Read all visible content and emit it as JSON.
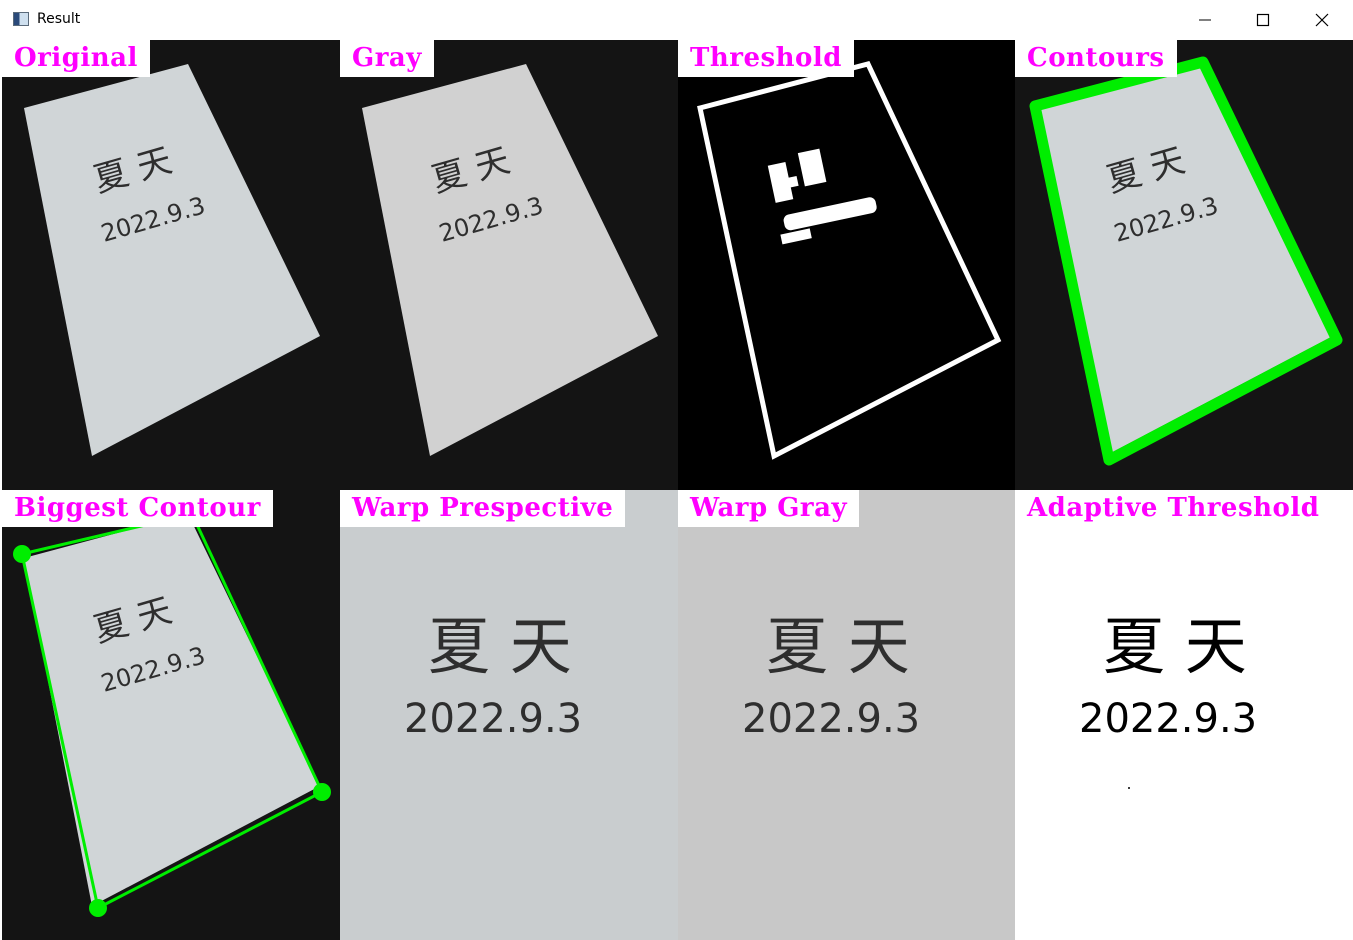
{
  "window": {
    "title": "Result"
  },
  "tiles": [
    {
      "label": "Original",
      "caption_cn": "夏 天",
      "caption_date": "2022.9.3"
    },
    {
      "label": "Gray",
      "caption_cn": "夏 天",
      "caption_date": "2022.9.3"
    },
    {
      "label": "Threshold"
    },
    {
      "label": "Contours",
      "caption_cn": "夏 天",
      "caption_date": "2022.9.3"
    },
    {
      "label": "Biggest Contour",
      "caption_cn": "夏 天",
      "caption_date": "2022.9.3"
    },
    {
      "label": "Warp Prespective",
      "caption_cn": "夏 天",
      "caption_date": "2022.9.3"
    },
    {
      "label": "Warp Gray",
      "caption_cn": "夏 天",
      "caption_date": "2022.9.3"
    },
    {
      "label": "Adaptive Threshold",
      "caption_cn": "夏 天",
      "caption_date": "2022.9.3"
    }
  ],
  "colors": {
    "label_text": "#ff00ff",
    "contour": "#00ee00",
    "paper": "#d2d6d8",
    "background": "#141414"
  },
  "icons": {
    "minimize": "minimize-icon",
    "maximize": "maximize-icon",
    "close": "close-icon",
    "app": "opencv-window-icon"
  }
}
